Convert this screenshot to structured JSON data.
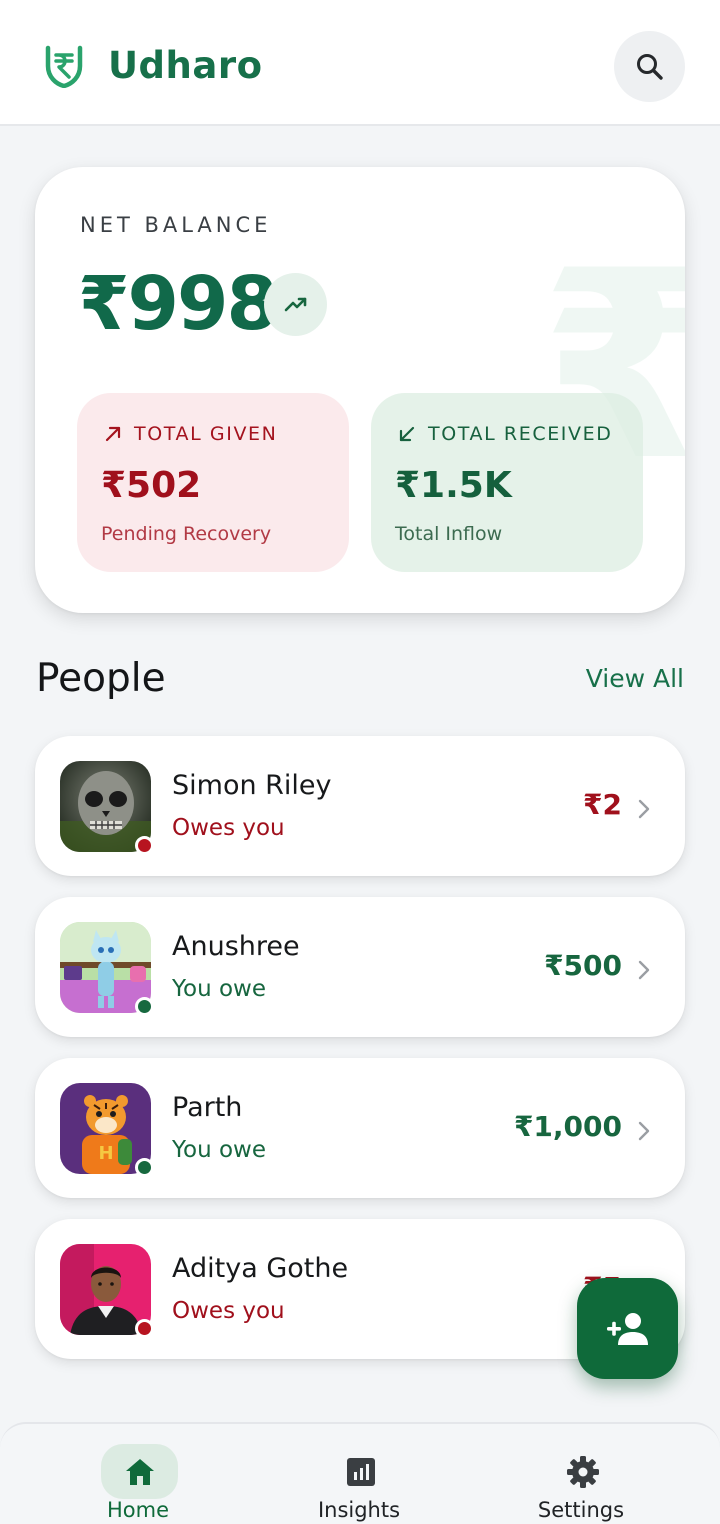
{
  "header": {
    "app_name": "Udharo",
    "logo_icon": "rupee-shield-icon",
    "search_icon": "search-icon"
  },
  "balance": {
    "label": "NET BALANCE",
    "amount": "₹998",
    "trend_icon": "trending-up-icon",
    "watermark": "₹",
    "given": {
      "label": "TOTAL GIVEN",
      "icon": "arrow-up-right-icon",
      "value": "₹502",
      "sub": "Pending Recovery"
    },
    "received": {
      "label": "TOTAL RECEIVED",
      "icon": "arrow-down-left-icon",
      "value": "₹1.5K",
      "sub": "Total Inflow"
    }
  },
  "people": {
    "title": "People",
    "view_all": "View All",
    "items": [
      {
        "name": "Simon Riley",
        "status": "Owes you",
        "amount": "₹2",
        "direction": "owes"
      },
      {
        "name": "Anushree",
        "status": "You owe",
        "amount": "₹500",
        "direction": "owe"
      },
      {
        "name": "Parth",
        "status": "You owe",
        "amount": "₹1,000",
        "direction": "owe"
      },
      {
        "name": "Aditya Gothe",
        "status": "Owes you",
        "amount": "₹5",
        "direction": "owes"
      }
    ]
  },
  "fab": {
    "icon": "add-person-icon"
  },
  "nav": {
    "home": "Home",
    "insights": "Insights",
    "settings": "Settings"
  },
  "colors": {
    "brand_green": "#17704a",
    "owes_red": "#a0101c",
    "owe_green": "#17663f"
  }
}
